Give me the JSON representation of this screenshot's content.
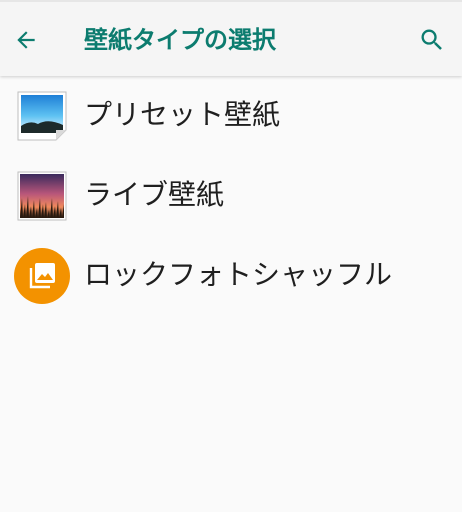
{
  "header": {
    "title": "壁紙タイプの選択",
    "accent_color": "#0c7c6f",
    "back_icon": "arrow-back-icon",
    "search_icon": "search-icon"
  },
  "items": [
    {
      "label": "プリセット壁紙",
      "icon": "preset-wallpaper-icon"
    },
    {
      "label": "ライブ壁紙",
      "icon": "live-wallpaper-icon"
    },
    {
      "label": "ロックフォトシャッフル",
      "icon": "photo-shuffle-icon"
    }
  ]
}
